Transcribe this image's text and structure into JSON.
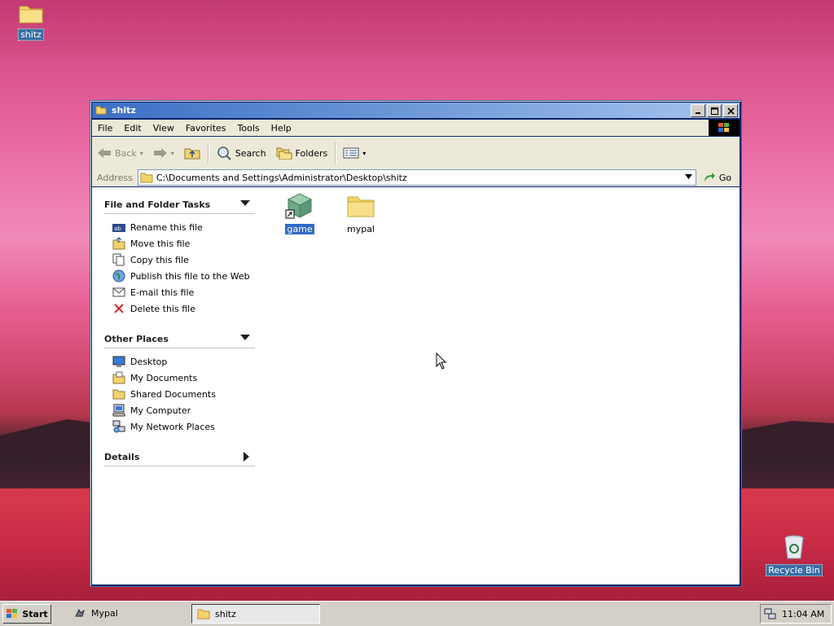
{
  "desktop": {
    "icons": [
      {
        "label": "shitz",
        "icon": "folder-icon"
      },
      {
        "label": "Recycle Bin",
        "icon": "recycle-bin-icon"
      }
    ]
  },
  "window": {
    "title": "shitz",
    "menu": [
      "File",
      "Edit",
      "View",
      "Favorites",
      "Tools",
      "Help"
    ],
    "toolbar": {
      "back": "Back",
      "search": "Search",
      "folders": "Folders"
    },
    "address": {
      "label": "Address",
      "value": "C:\\Documents and Settings\\Administrator\\Desktop\\shitz",
      "go": "Go"
    },
    "task_pane": {
      "file_tasks": {
        "title": "File and Folder Tasks",
        "items": [
          "Rename this file",
          "Move this file",
          "Copy this file",
          "Publish this file to the Web",
          "E-mail this file",
          "Delete this file"
        ]
      },
      "other_places": {
        "title": "Other Places",
        "items": [
          "Desktop",
          "My Documents",
          "Shared Documents",
          "My Computer",
          "My Network Places"
        ]
      },
      "details": {
        "title": "Details"
      }
    },
    "files": [
      {
        "name": "game",
        "icon": "shortcut-cube-icon",
        "selected": true
      },
      {
        "name": "mypal",
        "icon": "folder-icon",
        "selected": false
      }
    ]
  },
  "taskbar": {
    "start": "Start",
    "apps": [
      {
        "label": "Mypal",
        "active": false
      },
      {
        "label": "shitz",
        "active": true
      }
    ],
    "clock": "11:04 AM"
  },
  "colors": {
    "title_active_start": "#3b6ec5",
    "title_active_end": "#a6c4ee",
    "selection": "#316ac5",
    "chrome": "#ece9d8"
  }
}
